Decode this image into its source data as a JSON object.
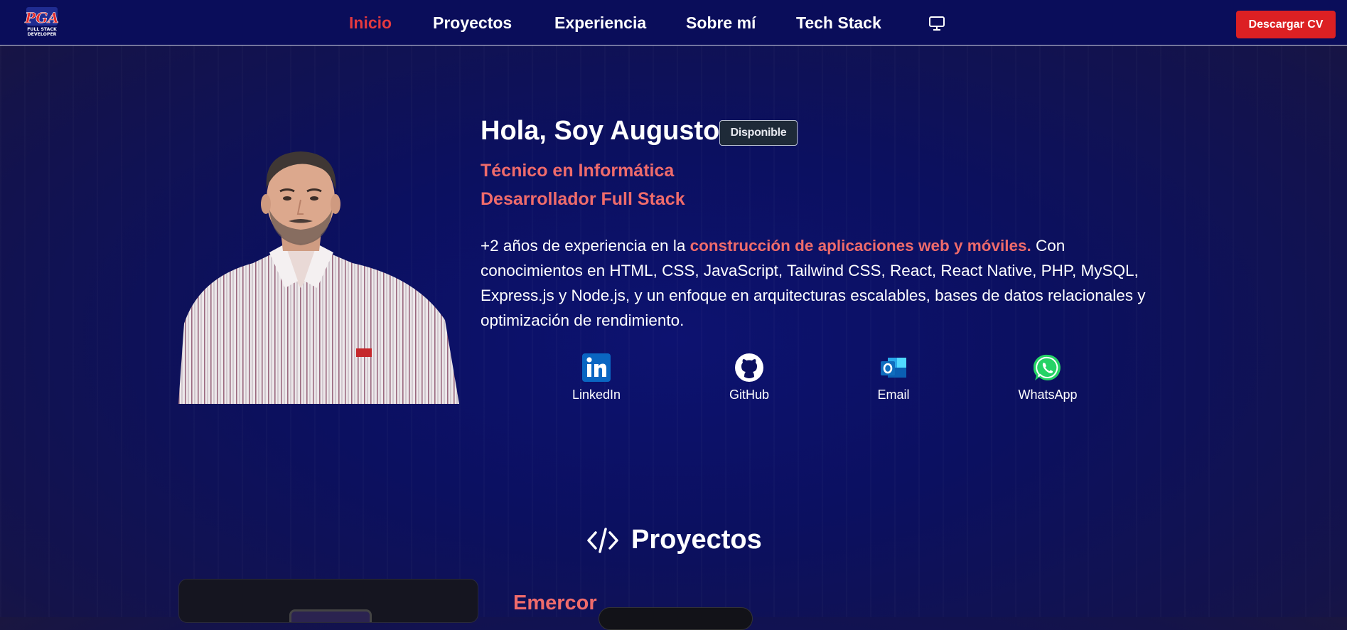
{
  "nav": {
    "logo_text": "PGA FULL STACK DEVELOPER",
    "links": [
      "Inicio",
      "Proyectos",
      "Experiencia",
      "Sobre mí",
      "Tech Stack"
    ],
    "cv_button": "Descargar CV"
  },
  "hero": {
    "greeting": "Hola, Soy Augusto",
    "badge": "Disponible",
    "role1": "Técnico en Informática",
    "role2": "Desarrollador Full Stack",
    "bio_start": "+2 años de experiencia en la ",
    "bio_highlight": "construcción de aplicaciones web y móviles.",
    "bio_end": " Con conocimientos en HTML, CSS, JavaScript, Tailwind CSS, React, React Native, PHP, MySQL, Express.js y Node.js, y un enfoque en arquitecturas escalables, bases de datos relacionales y optimización de rendimiento."
  },
  "social": [
    {
      "label": "LinkedIn",
      "icon": "linkedin-icon"
    },
    {
      "label": "GitHub",
      "icon": "github-icon"
    },
    {
      "label": "Email",
      "icon": "outlook-icon"
    },
    {
      "label": "WhatsApp",
      "icon": "whatsapp-icon"
    }
  ],
  "projects": {
    "heading": "Proyectos",
    "first_name": "Emercor"
  },
  "colors": {
    "accent": "#ef6b6b",
    "active_nav": "#e5393f",
    "cv_button": "#dc2023",
    "background": "#0b1060"
  }
}
